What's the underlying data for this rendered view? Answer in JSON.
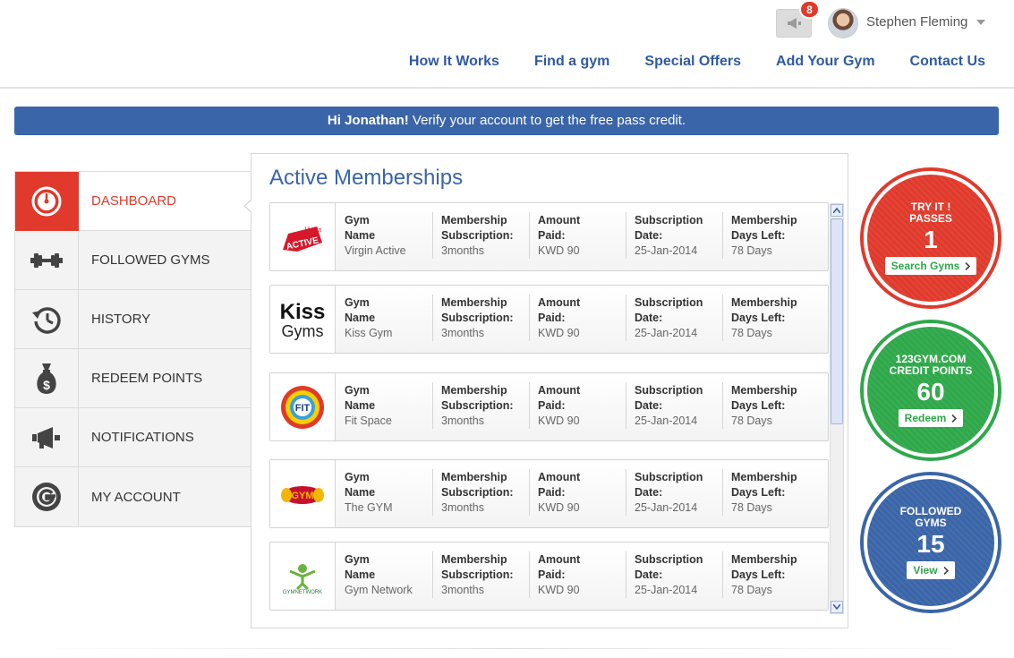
{
  "header": {
    "notification_count": "8",
    "username": "Stephen Fleming",
    "nav": [
      "How It Works",
      "Find a gym",
      "Special Offers",
      "Add Your Gym",
      "Contact Us"
    ]
  },
  "banner": {
    "greeting": "Hi Jonathan!",
    "message": " Verify your account to get the free pass credit."
  },
  "sidebar": {
    "items": [
      {
        "label": "DASHBOARD",
        "icon": "speedometer-icon",
        "active": true
      },
      {
        "label": "FOLLOWED GYMS",
        "icon": "dumbbell-icon",
        "active": false
      },
      {
        "label": "HISTORY",
        "icon": "history-icon",
        "active": false
      },
      {
        "label": "REDEEM POINTS",
        "icon": "money-bag-icon",
        "active": false
      },
      {
        "label": "NOTIFICATIONS",
        "icon": "megaphone-icon",
        "active": false
      },
      {
        "label": "MY ACCOUNT",
        "icon": "account-icon",
        "active": false
      }
    ]
  },
  "main": {
    "title": "Active Memberships",
    "column_labels": [
      "Gym\nName",
      "Membership\nSubscription:",
      "Amount\nPaid:",
      "Subscription\nDate:",
      "Membership\nDays Left:"
    ],
    "memberships": [
      {
        "logo": "Virgin Active",
        "gym": "Virgin Active",
        "subscription": "3months",
        "amount": "KWD 90",
        "date": "25-Jan-2014",
        "days_left": "78 Days"
      },
      {
        "logo": "Kiss Gyms",
        "gym": "Kiss Gym",
        "subscription": "3months",
        "amount": "KWD 90",
        "date": "25-Jan-2014",
        "days_left": "78 Days"
      },
      {
        "logo": "FIT",
        "gym": "Fit Space",
        "subscription": "3months",
        "amount": "KWD 90",
        "date": "25-Jan-2014",
        "days_left": "78 Days"
      },
      {
        "logo": "The GYM",
        "gym": "The GYM",
        "subscription": "3months",
        "amount": "KWD 90",
        "date": "25-Jan-2014",
        "days_left": "78 Days"
      },
      {
        "logo": "GYMNETWORK",
        "gym": "Gym Network",
        "subscription": "3months",
        "amount": "KWD 90",
        "date": "25-Jan-2014",
        "days_left": "78 Days"
      }
    ]
  },
  "stats": {
    "passes": {
      "title": "TRY IT !\nPASSES",
      "value": "1",
      "button": "Search Gyms",
      "color": "#e03a2c"
    },
    "credit": {
      "title": "123GYM.COM\nCREDIT POINTS",
      "value": "60",
      "button": "Redeem",
      "color": "#2fa84a"
    },
    "followed": {
      "title": "FOLLOWED\nGYMS",
      "value": "15",
      "button": "View",
      "color": "#3a65a8"
    }
  }
}
